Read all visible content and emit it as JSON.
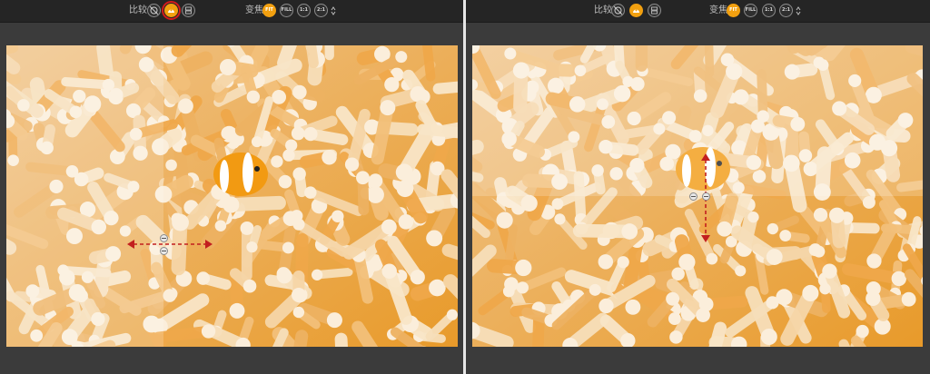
{
  "toolbar": {
    "compare_label": "比较",
    "zoom_label": "变焦",
    "zoom_options": [
      "FIT",
      "FILL",
      "1:1",
      "2:1"
    ]
  },
  "colors": {
    "accent": "#f2a010",
    "highlight": "#d41b1b",
    "arrow": "#c21f1f",
    "toolbar_bg": "#252525",
    "window_bg": "#3b3b3b",
    "divider": "#e6e6e6"
  },
  "icons": {
    "compare_modes": [
      "split-view-icon",
      "before-after-icon",
      "side-by-side-icon"
    ],
    "stepper": "chevron-up-down-icon"
  },
  "panels": [
    {
      "id": "left",
      "active_compare_mode": "before-after-icon",
      "active_zoom": "FIT",
      "split_direction": "vertical"
    },
    {
      "id": "right",
      "active_compare_mode": "before-after-icon",
      "active_zoom": "FIT",
      "split_direction": "horizontal"
    }
  ]
}
